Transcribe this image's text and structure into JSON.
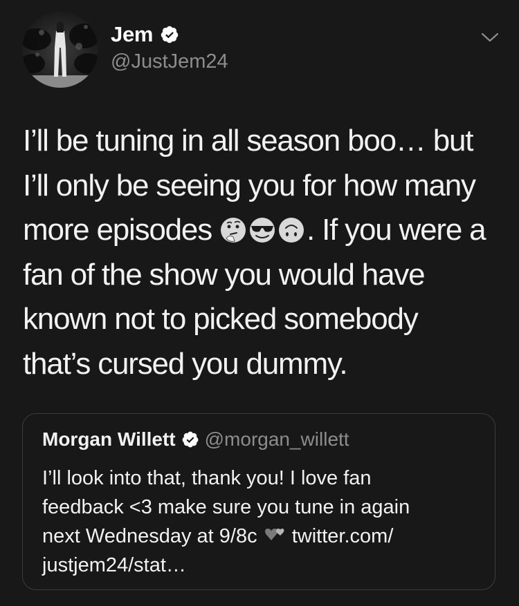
{
  "author": {
    "display_name": "Jem",
    "handle": "@JustJem24"
  },
  "tweet": {
    "line1": "I’ll be tuning in all season boo… but",
    "line2": "I’ll only be seeing you for how many",
    "line3_before": "more episodes ",
    "emojis": [
      "thinking-face-emoji",
      "sunglasses-face-emoji",
      "upside-down-face-emoji"
    ],
    "line3_after": ". If you were a",
    "line4": "fan of the show you would have",
    "line5": "known not to picked somebody",
    "line6": "that’s cursed you dummy."
  },
  "quoted_tweet": {
    "display_name": "Morgan Willett",
    "handle": "@morgan_willett",
    "line1": "I’ll look into that, thank you! I love fan",
    "line2": "feedback <3 make sure you tune in again",
    "line3_before": "next Wednesday at 9/8c ",
    "heart_icon": "two-hearts-emoji",
    "line3_after": " twitter.com/",
    "line4": "justjem24/stat…"
  },
  "colors": {
    "background": "#181818",
    "secondary_text": "#8d8d8d",
    "border": "#3d3d3d"
  }
}
